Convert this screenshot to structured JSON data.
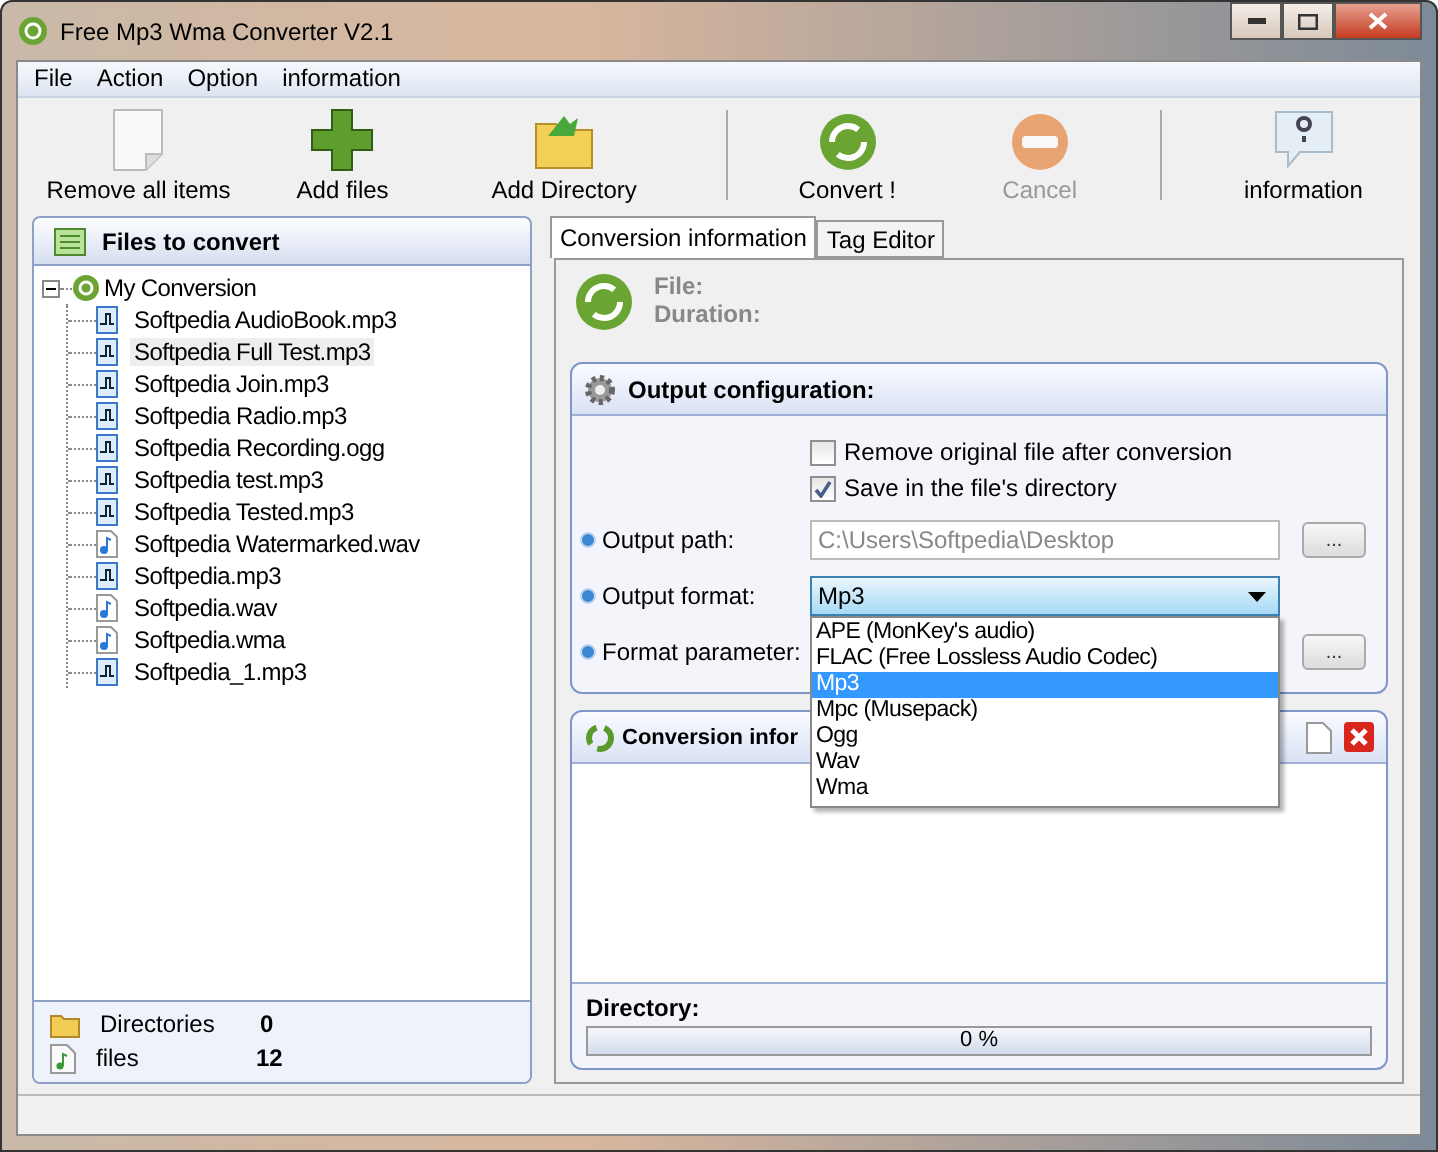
{
  "window": {
    "title": "Free Mp3 Wma Converter V2.1"
  },
  "menu": [
    "File",
    "Action",
    "Option",
    "information"
  ],
  "toolbar": [
    {
      "label": "Remove all items",
      "disabled": false
    },
    {
      "label": "Add files",
      "disabled": false
    },
    {
      "label": "Add Directory",
      "disabled": false
    },
    {
      "label": "Convert !",
      "disabled": false
    },
    {
      "label": "Cancel",
      "disabled": true
    },
    {
      "label": "information",
      "disabled": false
    }
  ],
  "files_panel": {
    "title": "Files to convert",
    "tree": {
      "label": "My Conversion",
      "expanded": true,
      "children": [
        {
          "label": "Softpedia AudioBook.mp3",
          "kind": "mp3",
          "selected": false
        },
        {
          "label": "Softpedia Full Test.mp3",
          "kind": "mp3",
          "selected": true
        },
        {
          "label": "Softpedia Join.mp3",
          "kind": "mp3",
          "selected": false
        },
        {
          "label": "Softpedia Radio.mp3",
          "kind": "mp3",
          "selected": false
        },
        {
          "label": "Softpedia Recording.ogg",
          "kind": "mp3",
          "selected": false
        },
        {
          "label": "Softpedia test.mp3",
          "kind": "mp3",
          "selected": false
        },
        {
          "label": "Softpedia Tested.mp3",
          "kind": "mp3",
          "selected": false
        },
        {
          "label": "Softpedia Watermarked.wav",
          "kind": "note",
          "selected": false
        },
        {
          "label": "Softpedia.mp3",
          "kind": "mp3",
          "selected": false
        },
        {
          "label": "Softpedia.wav",
          "kind": "note",
          "selected": false
        },
        {
          "label": "Softpedia.wma",
          "kind": "note",
          "selected": false
        },
        {
          "label": "Softpedia_1.mp3",
          "kind": "mp3",
          "selected": false
        }
      ]
    },
    "summary": [
      {
        "label": "Directories",
        "value": "0",
        "kind": "folder"
      },
      {
        "label": "files",
        "value": "12",
        "kind": "file"
      }
    ]
  },
  "tabs": [
    {
      "label": "Conversion information",
      "selected": true
    },
    {
      "label": "Tag Editor",
      "selected": false
    }
  ],
  "conversion": {
    "file_label": "File:",
    "duration_label": "Duration:",
    "output_config": {
      "title": "Output configuration:",
      "checkboxes": [
        {
          "label": "Remove original file after conversion",
          "checked": false
        },
        {
          "label": "Save in the file's directory",
          "checked": true
        }
      ],
      "output_path": {
        "label": "Output path:",
        "value": "C:\\Users\\Softpedia\\Desktop",
        "disabled": true,
        "button": "..."
      },
      "output_format": {
        "label": "Output format:",
        "value": "Mp3",
        "expanded": true,
        "options": [
          {
            "label": "APE (MonKey's audio)",
            "selected": false
          },
          {
            "label": "FLAC (Free Lossless Audio Codec)",
            "selected": false
          },
          {
            "label": "Mp3",
            "selected": true
          },
          {
            "label": "Mpc (Musepack)",
            "selected": false
          },
          {
            "label": "Ogg",
            "selected": false
          },
          {
            "label": "Wav",
            "selected": false
          },
          {
            "label": "Wma",
            "selected": false
          }
        ]
      },
      "format_parameter": {
        "label": "Format parameter:",
        "button": "..."
      }
    },
    "conversion_info": {
      "title": "Conversion infor",
      "directory_label": "Directory:",
      "progress": {
        "level": 0,
        "reading": "0 %"
      }
    }
  }
}
